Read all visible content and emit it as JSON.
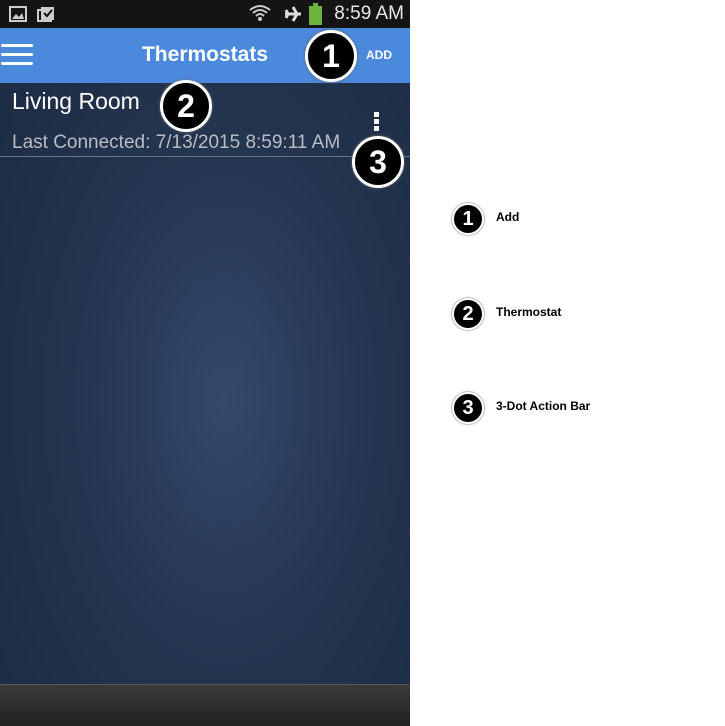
{
  "status_bar": {
    "time": "8:59 AM",
    "icons": [
      "image-icon",
      "clipboard-check-icon",
      "wifi-icon",
      "airplane-icon",
      "battery-icon"
    ],
    "battery_color": "#6cb33f"
  },
  "app_bar": {
    "title": "Thermostats",
    "add_label": "ADD",
    "color": "#4a89dc"
  },
  "thermostats": [
    {
      "name": "Living Room",
      "last_connected": "Last Connected: 7/13/2015 8:59:11 AM"
    }
  ],
  "callouts": [
    {
      "number": "1",
      "label": "Add"
    },
    {
      "number": "2",
      "label": "Thermostat"
    },
    {
      "number": "3",
      "label": "3-Dot Action Bar"
    }
  ]
}
